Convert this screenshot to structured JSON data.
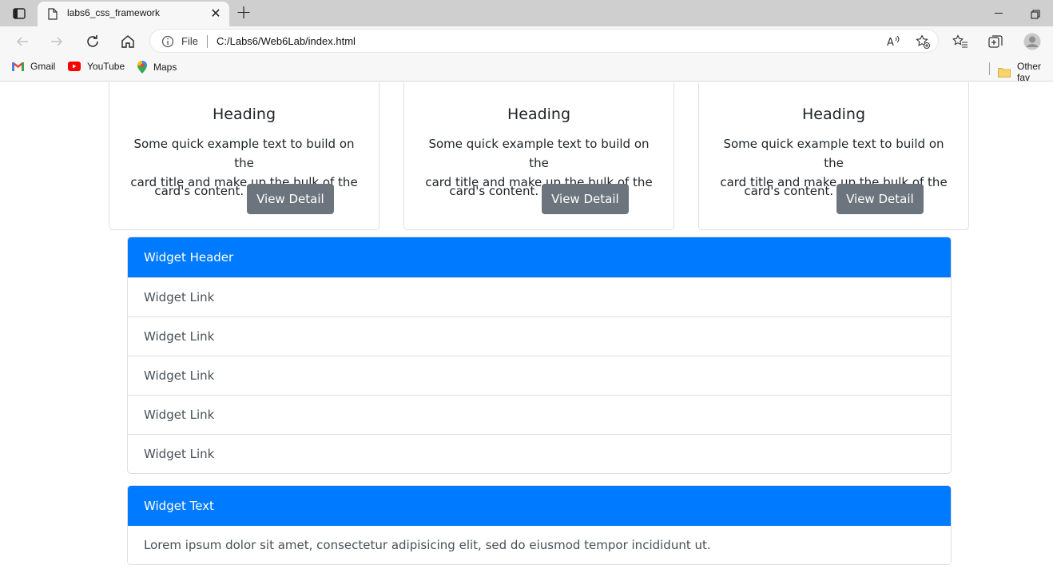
{
  "browser": {
    "tab_title": "labs6_css_framework",
    "address_scheme_label": "File",
    "url": "C:/Labs6/Web6Lab/index.html",
    "bookmarks": [
      {
        "label": "Gmail",
        "icon": "gmail-icon"
      },
      {
        "label": "YouTube",
        "icon": "youtube-icon"
      },
      {
        "label": "Maps",
        "icon": "maps-icon"
      }
    ],
    "other_favorites_label": "Other fav"
  },
  "cards": [
    {
      "title": "Heading",
      "text_line1": "Some quick example text to build on the",
      "text_line2": "card title and make up the bulk of the",
      "text_line3": "card's content.",
      "button_label": "View Detail"
    },
    {
      "title": "Heading",
      "text_line1": "Some quick example text to build on the",
      "text_line2": "card title and make up the bulk of the",
      "text_line3": "card's content.",
      "button_label": "View Detail"
    },
    {
      "title": "Heading",
      "text_line1": "Some quick example text to build on the",
      "text_line2": "card title and make up the bulk of the",
      "text_line3": "card's content.",
      "button_label": "View Detail"
    }
  ],
  "widget_links": {
    "header": "Widget Header",
    "links": [
      "Widget Link",
      "Widget Link",
      "Widget Link",
      "Widget Link",
      "Widget Link"
    ]
  },
  "widget_text": {
    "header": "Widget Text",
    "body": "Lorem ipsum dolor sit amet, consectetur adipisicing elit, sed do eiusmod tempor incididunt ut."
  },
  "colors": {
    "primary": "#007bff",
    "secondary_button": "#6c757d",
    "card_image": "#6f6ff2"
  }
}
